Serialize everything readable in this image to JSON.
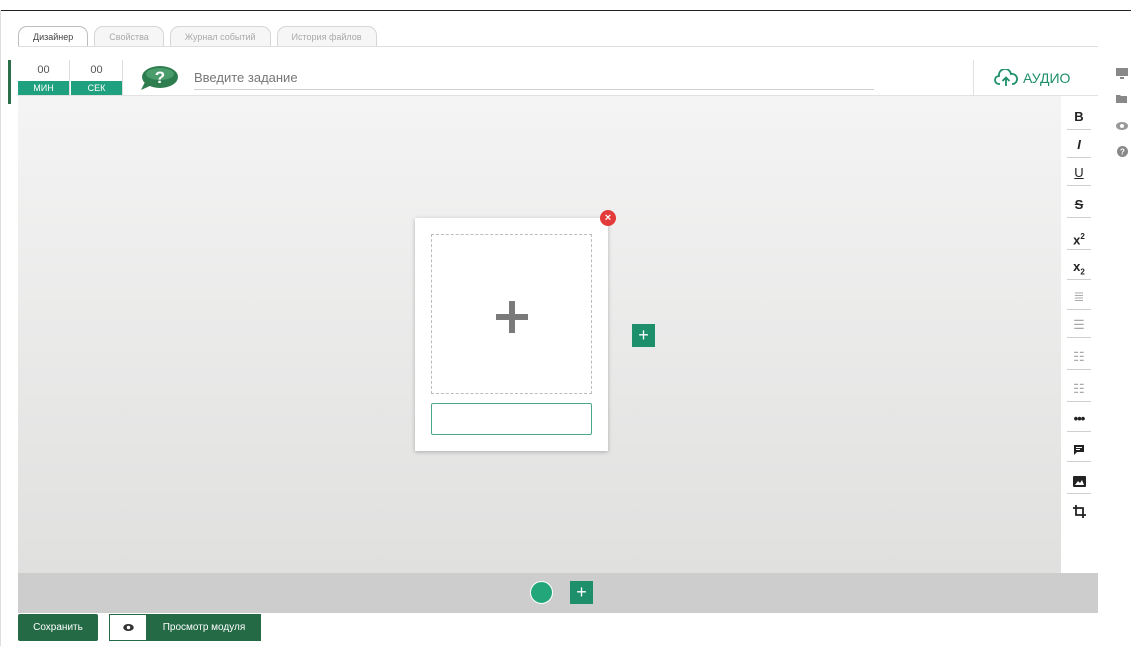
{
  "tabs": [
    {
      "label": "Дизайнер",
      "active": true
    },
    {
      "label": "Свойства",
      "active": false
    },
    {
      "label": "Журнал событий",
      "active": false
    },
    {
      "label": "История файлов",
      "active": false
    }
  ],
  "timer": {
    "minutes": "00",
    "minutes_label": "МИН",
    "seconds": "00",
    "seconds_label": "СЕК"
  },
  "task": {
    "placeholder": "Введите задание",
    "value": ""
  },
  "audio": {
    "label": "АУДИО",
    "icon": "cloud-upload-icon"
  },
  "format_toolbar": [
    {
      "name": "bold-button",
      "glyph": "B"
    },
    {
      "name": "italic-button",
      "glyph": "I"
    },
    {
      "name": "underline-button",
      "glyph": "U"
    },
    {
      "name": "strikethrough-button",
      "glyph": "S"
    },
    {
      "name": "superscript-button",
      "glyph": "x²"
    },
    {
      "name": "subscript-button",
      "glyph": "x₂"
    },
    {
      "name": "align-left-button",
      "glyph": "≡"
    },
    {
      "name": "align-center-button",
      "glyph": "≡"
    },
    {
      "name": "bullet-list-button",
      "glyph": "☰"
    },
    {
      "name": "numbered-list-button",
      "glyph": "☰"
    },
    {
      "name": "more-button",
      "glyph": "•••"
    },
    {
      "name": "comment-button",
      "glyph": "▬"
    },
    {
      "name": "image-button",
      "glyph": "▲"
    },
    {
      "name": "crop-button",
      "glyph": "⧉"
    }
  ],
  "side_icons": [
    "monitor-icon",
    "folder-icon",
    "eye-icon",
    "help-icon"
  ],
  "bottom": {
    "save_label": "Сохранить",
    "preview_label": "Просмотр модуля",
    "add_symbol": "+"
  },
  "colors": {
    "accent": "#1d8f6a",
    "dark_green": "#236a45",
    "close_red": "#e33b3b"
  }
}
